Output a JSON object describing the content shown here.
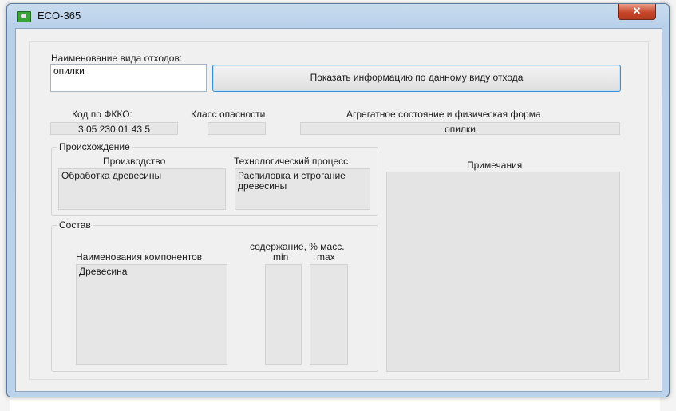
{
  "window": {
    "title": "ECO-365",
    "close_symbol": "✕",
    "icon": "app-icon"
  },
  "waste": {
    "name_label": "Наименование вида отходов:",
    "name_value": "опилки",
    "show_button": "Показать информацию по данному виду отхода"
  },
  "codes": {
    "fkko_label": "Код по ФККО:",
    "fkko_value": "3 05 230 01 43 5",
    "hazard_label": "Класс опасности",
    "hazard_value": "",
    "state_label": "Агрегатное состояние и физическая форма",
    "state_value": "опилки"
  },
  "origin": {
    "title": "Происхождение",
    "production_label": "Производство",
    "production_value": "Обработка древесины",
    "process_label": "Технологический процесс",
    "process_value": "Распиловка и строгание древесины"
  },
  "notes": {
    "label": "Примечания",
    "value": ""
  },
  "composition": {
    "title": "Состав",
    "components_label": "Наименования компонентов",
    "content_label": "содержание, % масс.",
    "min_label": "min",
    "max_label": "max",
    "components_value": "Древесина",
    "min_value": "",
    "max_value": ""
  }
}
